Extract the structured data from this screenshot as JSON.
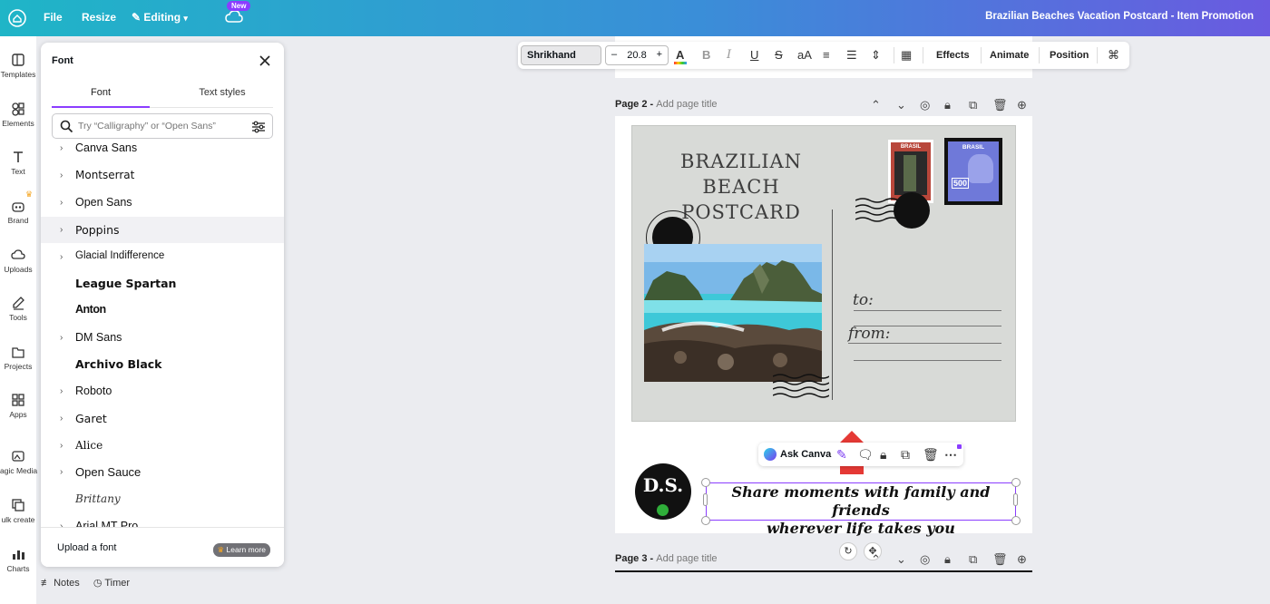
{
  "topbar": {
    "file": "File",
    "resize": "Resize",
    "editing": "Editing",
    "new_badge": "New",
    "title": "Brazilian Beaches Vacation Postcard - Item Promotion"
  },
  "rail": [
    {
      "label": "Templates",
      "icon": "templates-icon"
    },
    {
      "label": "Elements",
      "icon": "elements-icon"
    },
    {
      "label": "Text",
      "icon": "text-icon"
    },
    {
      "label": "Brand",
      "icon": "brand-icon"
    },
    {
      "label": "Uploads",
      "icon": "uploads-icon"
    },
    {
      "label": "Tools",
      "icon": "tools-icon"
    },
    {
      "label": "Projects",
      "icon": "projects-icon"
    },
    {
      "label": "Apps",
      "icon": "apps-icon"
    },
    {
      "label": "agic Media",
      "icon": "magic-media-icon"
    },
    {
      "label": "ulk create",
      "icon": "bulk-create-icon"
    },
    {
      "label": "Charts",
      "icon": "charts-icon"
    }
  ],
  "font_panel": {
    "header": "Font",
    "tab_font": "Font",
    "tab_text_styles": "Text styles",
    "search_placeholder": "Try “Calligraphy” or “Open Sans”",
    "fonts": [
      {
        "name": "Canva Sans",
        "chevron": true
      },
      {
        "name": "Montserrat",
        "chevron": true
      },
      {
        "name": "Open Sans",
        "chevron": true
      },
      {
        "name": "Poppins",
        "chevron": true,
        "highlighted": true
      },
      {
        "name": "Glacial Indifference",
        "chevron": true
      },
      {
        "name": "League Spartan",
        "chevron": false
      },
      {
        "name": "Anton",
        "chevron": false
      },
      {
        "name": "DM Sans",
        "chevron": true
      },
      {
        "name": "Archivo Black",
        "chevron": false
      },
      {
        "name": "Roboto",
        "chevron": true
      },
      {
        "name": "Garet",
        "chevron": true
      },
      {
        "name": "Alice",
        "chevron": true
      },
      {
        "name": "Open Sauce",
        "chevron": true
      },
      {
        "name": "Brittany",
        "chevron": false
      },
      {
        "name": "Arial MT Pro",
        "chevron": true
      }
    ],
    "upload": "Upload a font",
    "learn_more": "Learn more"
  },
  "toolbar": {
    "font": "Shrikhand",
    "size": "20.8",
    "effects": "Effects",
    "animate": "Animate",
    "position": "Position"
  },
  "pages": {
    "page2_label": "Page 2 -",
    "page2_title": "Add page title",
    "page3_label": "Page 3 -",
    "page3_title": "Add page title"
  },
  "postcard": {
    "title_line1": "BRAZILIAN BEACH",
    "title_line2": "POSTCARD",
    "to": "to:",
    "from": "from:",
    "stamp1_text": "BRASIL",
    "stamp2_text": "BRASIL",
    "stamp2_value": "500"
  },
  "context_menu": {
    "ask": "Ask Canva"
  },
  "caption": {
    "line1": "Share moments with family and friends",
    "line2": "wherever life takes you"
  },
  "logo": {
    "text": "D.S."
  },
  "bottom": {
    "notes": "Notes",
    "timer": "Timer"
  },
  "colors": {
    "accent": "#8b3dff",
    "highlight_arrow": "#e53935"
  }
}
